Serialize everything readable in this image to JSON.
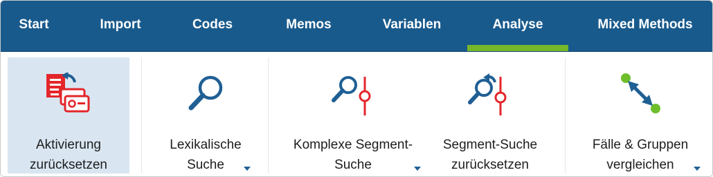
{
  "tabs": {
    "start": "Start",
    "import": "Import",
    "codes": "Codes",
    "memos": "Memos",
    "variablen": "Variablen",
    "analyse": "Analyse",
    "mixed_methods": "Mixed Methods"
  },
  "active_tab": "Analyse",
  "ribbon": {
    "aktivierung": {
      "line1": "Aktivierung",
      "line2": "zurücksetzen",
      "icon": "reset-activation-icon"
    },
    "lexikalische": {
      "line1": "Lexikalische",
      "line2": "Suche",
      "icon": "magnifier-icon"
    },
    "komplexe": {
      "line1": "Komplexe Segment-",
      "line2": "Suche",
      "icon": "complex-segment-search-icon"
    },
    "segment_reset": {
      "line1": "Segment-Suche",
      "line2": "zurücksetzen",
      "icon": "reset-segment-search-icon"
    },
    "faelle": {
      "line1": "Fälle & Gruppen",
      "line2": "vergleichen",
      "icon": "compare-cases-icon"
    }
  },
  "colors": {
    "tabbar": "#195a8c",
    "active_indicator": "#76b82a",
    "selected_button": "#d9e6f2",
    "icon_red": "#e3262b",
    "icon_blue": "#1f5f94",
    "icon_green": "#6fbe2c"
  }
}
